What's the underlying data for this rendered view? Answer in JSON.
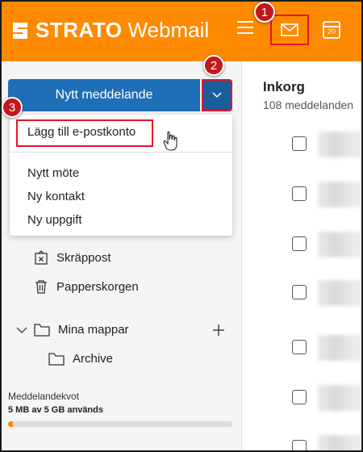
{
  "header": {
    "brand": "STRATO",
    "product": "Webmail",
    "calendar_day": "20"
  },
  "compose": {
    "label": "Nytt meddelande"
  },
  "dropdown": {
    "items": [
      "Lägg till e-postkonto",
      "Nytt möte",
      "Ny kontakt",
      "Ny uppgift"
    ]
  },
  "folders": {
    "spam": "Skräppost",
    "trash": "Papperskorgen",
    "my_folders": "Mina mappar",
    "archive": "Archive"
  },
  "quota": {
    "label": "Meddelandekvot",
    "value": "5 MB av 5 GB används",
    "fill_fraction": 0.02
  },
  "inbox": {
    "title": "Inkorg",
    "count": "108 meddelanden"
  },
  "markers": [
    "1",
    "2",
    "3"
  ],
  "colors": {
    "accent": "#ff8a00",
    "compose": "#1f6fb8",
    "highlight": "#e8132a",
    "marker": "#c4161c"
  }
}
